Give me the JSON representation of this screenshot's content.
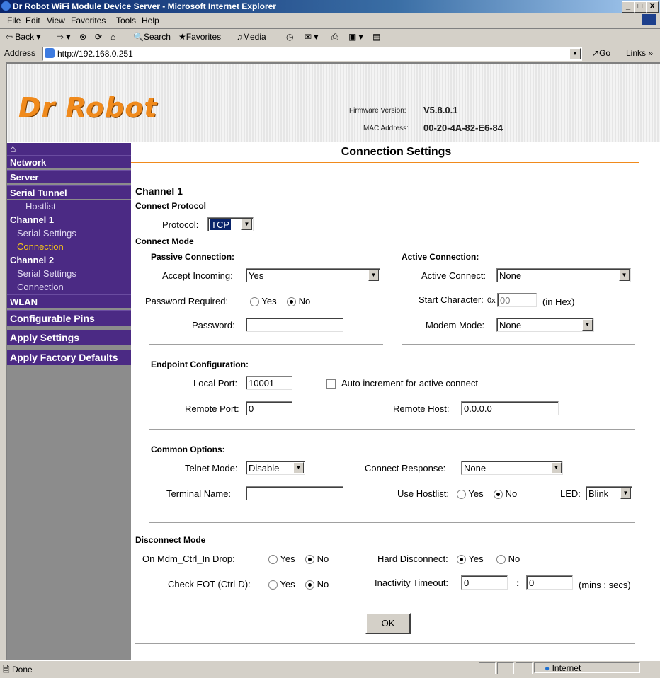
{
  "window": {
    "title": "Dr Robot WiFi Module Device Server - Microsoft Internet Explorer",
    "minimize": "_",
    "maximize": "□",
    "close": "X"
  },
  "menubar": [
    "File",
    "Edit",
    "View",
    "Favorites",
    "Tools",
    "Help"
  ],
  "toolbar": {
    "back": "Back",
    "search": "Search",
    "favorites": "Favorites",
    "media": "Media"
  },
  "address": {
    "label": "Address",
    "url": "http://192.168.0.251",
    "go": "Go",
    "links": "Links"
  },
  "header": {
    "logo": "Dr Robot",
    "firmware_label": "Firmware Version:",
    "firmware_value": "V5.8.0.1",
    "mac_label": "MAC Address:",
    "mac_value": "00-20-4A-82-E6-84"
  },
  "sidebar": {
    "home_icon": "home-icon",
    "items": [
      {
        "label": "Network"
      },
      {
        "label": "Server"
      },
      {
        "label": "Serial Tunnel"
      },
      {
        "label": "Hostlist"
      },
      {
        "label": "Channel 1"
      },
      {
        "label": "Serial Settings"
      },
      {
        "label": "Connection"
      },
      {
        "label": "Channel 2"
      },
      {
        "label": "Serial Settings"
      },
      {
        "label": "Connection"
      },
      {
        "label": "WLAN"
      },
      {
        "label": "Configurable Pins"
      },
      {
        "label": "Apply Settings"
      },
      {
        "label": "Apply Factory Defaults"
      }
    ],
    "active_color": "#f5c518"
  },
  "page": {
    "title": "Connection Settings",
    "channel": "Channel 1",
    "connect_protocol": "Connect Protocol",
    "protocol_label": "Protocol:",
    "protocol_value": "TCP",
    "connect_mode": "Connect Mode",
    "passive_heading": "Passive Connection:",
    "accept_incoming_label": "Accept Incoming:",
    "accept_incoming_value": "Yes",
    "password_required_label": "Password Required:",
    "password_label": "Password:",
    "password_value": "",
    "active_heading": "Active Connection:",
    "active_connect_label": "Active Connect:",
    "active_connect_value": "None",
    "start_char_label": "Start Character:",
    "start_char_prefix": "0x",
    "start_char_value": "00",
    "start_char_hint": "(in Hex)",
    "modem_mode_label": "Modem Mode:",
    "modem_mode_value": "None",
    "endpoint_heading": "Endpoint Configuration:",
    "local_port_label": "Local Port:",
    "local_port_value": "10001",
    "auto_increment_label": "Auto increment for active connect",
    "remote_port_label": "Remote Port:",
    "remote_port_value": "0",
    "remote_host_label": "Remote Host:",
    "remote_host_value": "0.0.0.0",
    "common_heading": "Common Options:",
    "telnet_label": "Telnet Mode:",
    "telnet_value": "Disable",
    "connect_response_label": "Connect Response:",
    "connect_response_value": "None",
    "terminal_label": "Terminal Name:",
    "terminal_value": "",
    "use_hostlist_label": "Use Hostlist:",
    "led_label": "LED:",
    "led_value": "Blink",
    "disconnect_heading": "Disconnect Mode",
    "mdm_label": "On Mdm_Ctrl_In Drop:",
    "hard_disconnect_label": "Hard Disconnect:",
    "check_eot_label": "Check EOT (Ctrl-D):",
    "inactivity_label": "Inactivity Timeout:",
    "inactivity_mins": "0",
    "inactivity_secs": "0",
    "inactivity_sep": ":",
    "inactivity_unit": "(mins : secs)",
    "yes": "Yes",
    "no": "No",
    "ok_button": "OK"
  },
  "status": {
    "left": "Done",
    "zone": "Internet"
  }
}
